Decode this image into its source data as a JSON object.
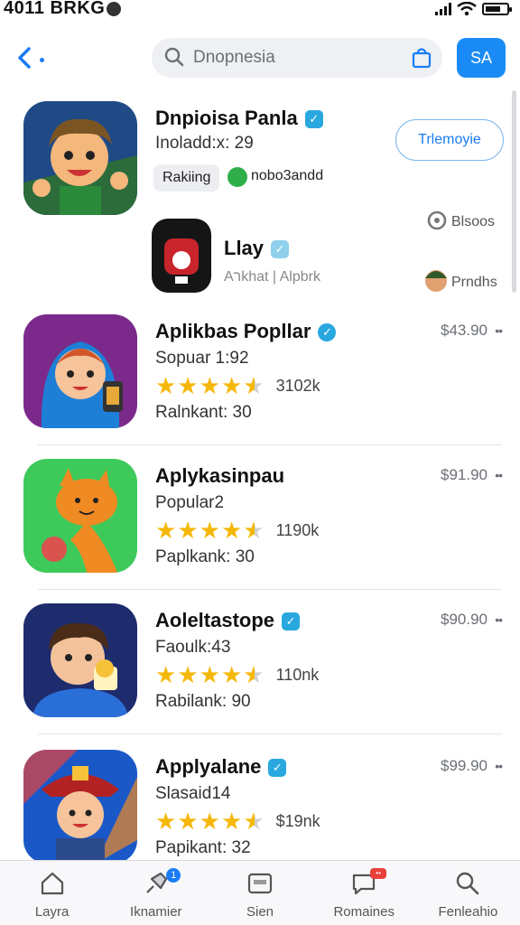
{
  "status_bar": {
    "time": "4011 BRKG"
  },
  "header": {
    "search_placeholder": "Dnopnesia",
    "top_button": "SA"
  },
  "featured": {
    "title": "Dnpioisa Panla",
    "subtitle": "Inoladd:x: 29",
    "pill": "Rakiing",
    "tag": "nobo3andd",
    "action_button": "Trlemoyie",
    "side_link_1": "Blsoos",
    "side_link_2": "Prndhs",
    "mini_title": "Llay",
    "mini_subtitle": "Aרkhat | Alpbrk",
    "icon": "cartoon-boy-icon",
    "mini_icon": "bear-mask-icon"
  },
  "apps": [
    {
      "title": "Aplikbas Popllar",
      "line2": "Sopuar 1:92",
      "rating": 4.5,
      "count": "3102k",
      "line3": "Ralnkant: 30",
      "price": "$43.90",
      "icon": "hooded-girl-icon",
      "badge": "round"
    },
    {
      "title": "Aplykasinpau",
      "line2": "Popular2",
      "rating": 4.5,
      "count": "1190k",
      "line3": "Paplkank: 30",
      "price": "$91.90",
      "icon": "orange-cat-icon",
      "badge": ""
    },
    {
      "title": "Aoleltastope",
      "line2": "Faoulk:43",
      "rating": 4.5,
      "count": "110nk",
      "line3": "Rabilank: 90",
      "price": "$90.90",
      "icon": "boy-with-drink-icon",
      "badge": "square"
    },
    {
      "title": "Applyalane",
      "line2": "Slasaid14",
      "rating": 4.5,
      "count": "$19nk",
      "line3": "Papikant: 32",
      "price": "$99.90",
      "icon": "firefighter-boy-icon",
      "badge": "square"
    }
  ],
  "tabs": [
    {
      "label": "Layra",
      "icon": "home-icon"
    },
    {
      "label": "Iknamier",
      "icon": "rocket-icon",
      "badge": "1"
    },
    {
      "label": "Sien",
      "icon": "card-icon"
    },
    {
      "label": "Romaines",
      "icon": "chat-icon",
      "badge": "••"
    },
    {
      "label": "Fenleahio",
      "icon": "search-icon"
    }
  ],
  "colors": {
    "accent": "#1a8bf5",
    "star": "#f5b80a",
    "verified": "#29a8e0"
  }
}
